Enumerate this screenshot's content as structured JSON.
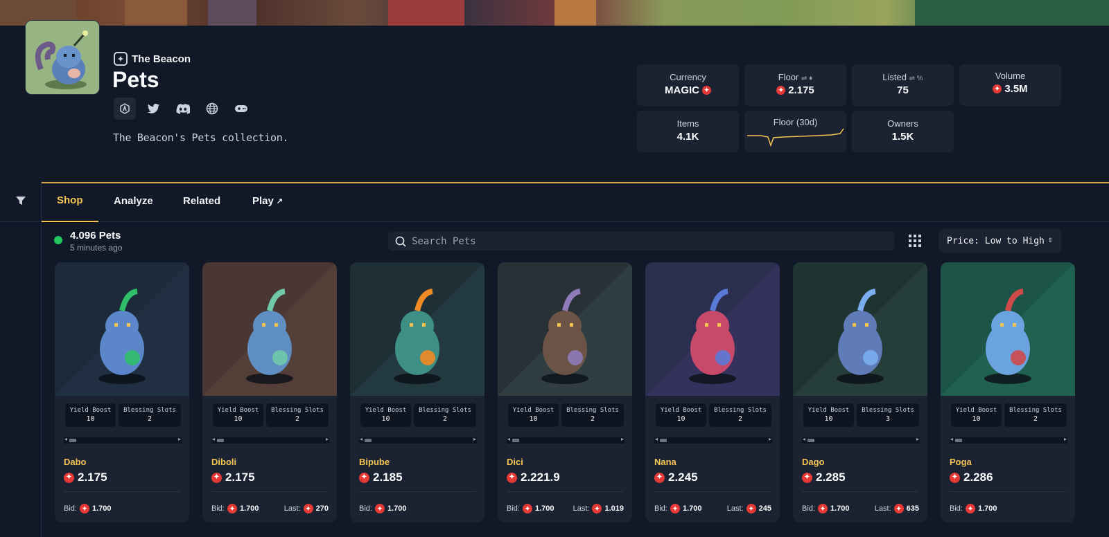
{
  "collection": {
    "brand": "The Beacon",
    "title": "Pets",
    "description": "The Beacon's Pets collection."
  },
  "socials": [
    "arbitrum-icon",
    "twitter-icon",
    "discord-icon",
    "globe-icon",
    "gamepad-icon"
  ],
  "stats": {
    "currency": {
      "label": "Currency",
      "value": "MAGIC"
    },
    "floor": {
      "label": "Floor",
      "value": "2.175"
    },
    "listed": {
      "label": "Listed",
      "value": "75"
    },
    "volume": {
      "label": "Volume",
      "value": "3.5M"
    },
    "items": {
      "label": "Items",
      "value": "4.1K"
    },
    "floor30d": {
      "label": "Floor (30d)"
    },
    "owners": {
      "label": "Owners",
      "value": "1.5K"
    }
  },
  "tabs": [
    {
      "label": "Shop",
      "active": true
    },
    {
      "label": "Analyze"
    },
    {
      "label": "Related"
    },
    {
      "label": "Play"
    }
  ],
  "listing": {
    "count": "4.096 Pets",
    "updated": "5 minutes ago",
    "search_placeholder": "Search Pets",
    "sort": "Price: Low to High"
  },
  "colors": {
    "accent": "#f6c453",
    "magic": "#e53935",
    "online": "#22c55e",
    "panel": "#1b2332"
  },
  "cards": [
    {
      "name": "Dabo",
      "price": "2.175",
      "yield_label": "Yield Boost",
      "yield": "10",
      "slots_label": "Blessing Slots",
      "slots": "2",
      "bid_label": "Bid:",
      "bid": "1.700",
      "last_label": "",
      "last": ""
    },
    {
      "name": "Diboli",
      "price": "2.175",
      "yield_label": "Yield Boost",
      "yield": "10",
      "slots_label": "Blessing Slots",
      "slots": "2",
      "bid_label": "Bid:",
      "bid": "1.700",
      "last_label": "Last:",
      "last": "270"
    },
    {
      "name": "Bipube",
      "price": "2.185",
      "yield_label": "Yield Boost",
      "yield": "10",
      "slots_label": "Blessing Slots",
      "slots": "2",
      "bid_label": "Bid:",
      "bid": "1.700",
      "last_label": "",
      "last": ""
    },
    {
      "name": "Dici",
      "price": "2.221.9",
      "yield_label": "Yield Boost",
      "yield": "10",
      "slots_label": "Blessing Slots",
      "slots": "2",
      "bid_label": "Bid:",
      "bid": "1.700",
      "last_label": "Last:",
      "last": "1.019"
    },
    {
      "name": "Nana",
      "price": "2.245",
      "yield_label": "Yield Boost",
      "yield": "10",
      "slots_label": "Blessing Slots",
      "slots": "2",
      "bid_label": "Bid:",
      "bid": "1.700",
      "last_label": "Last:",
      "last": "245"
    },
    {
      "name": "Dago",
      "price": "2.285",
      "yield_label": "Yield Boost",
      "yield": "10",
      "slots_label": "Blessing Slots",
      "slots": "3",
      "bid_label": "Bid:",
      "bid": "1.700",
      "last_label": "Last:",
      "last": "635"
    },
    {
      "name": "Poga",
      "price": "2.286",
      "yield_label": "Yield Boost",
      "yield": "10",
      "slots_label": "Blessing Slots",
      "slots": "2",
      "bid_label": "Bid:",
      "bid": "1.700",
      "last_label": "",
      "last": ""
    }
  ]
}
